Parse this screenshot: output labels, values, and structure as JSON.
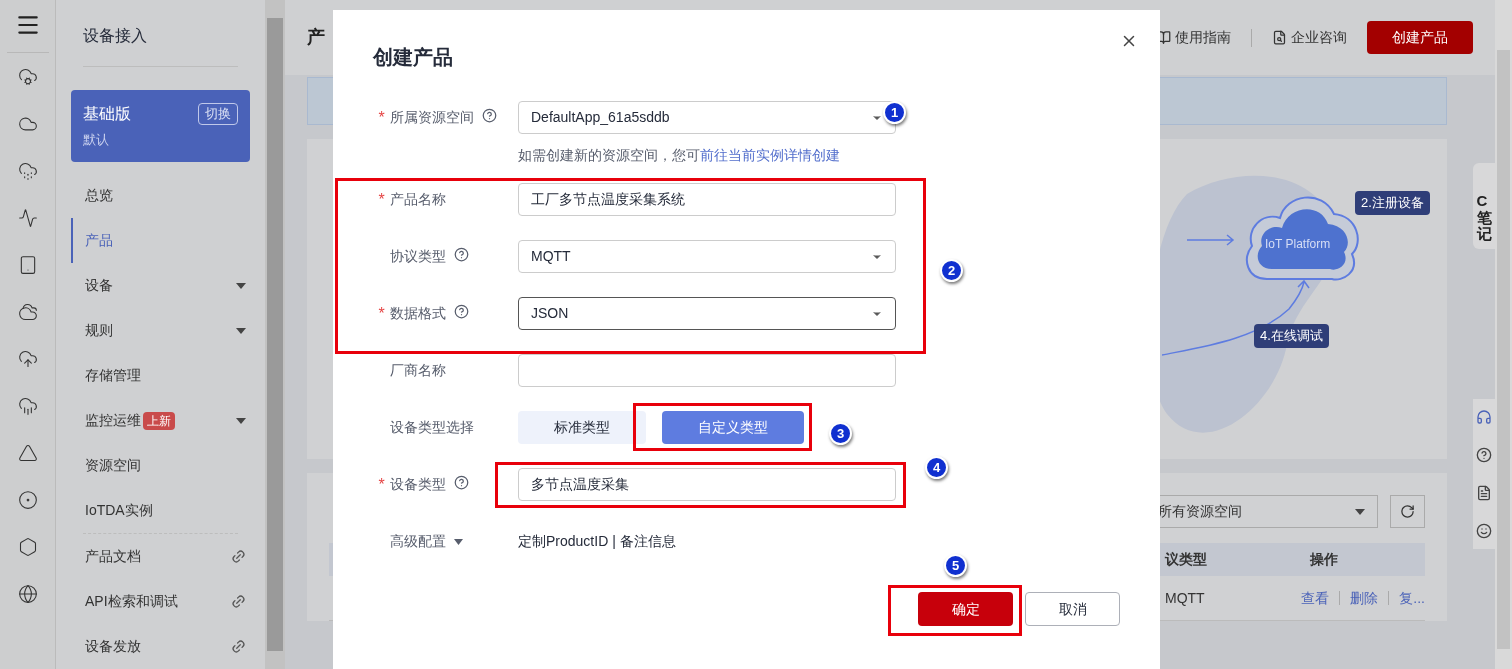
{
  "sidebar": {
    "title": "设备接入",
    "instance": {
      "name": "基础版",
      "switch": "切换",
      "note": "默认"
    },
    "items": [
      {
        "label": "总览",
        "selected": false
      },
      {
        "label": "产品",
        "selected": true
      },
      {
        "label": "设备",
        "selected": false,
        "kind": "group"
      },
      {
        "label": "规则",
        "selected": false,
        "kind": "group"
      },
      {
        "label": "存储管理",
        "selected": false
      },
      {
        "label": "监控运维",
        "selected": false,
        "kind": "group",
        "badge": "上新"
      },
      {
        "label": "资源空间",
        "selected": false
      },
      {
        "label": "IoTDA实例",
        "selected": false
      },
      {
        "label": "产品文档",
        "selected": false,
        "kind": "link"
      },
      {
        "label": "API检索和调试",
        "selected": false,
        "kind": "link"
      },
      {
        "label": "设备发放",
        "selected": false,
        "kind": "link"
      }
    ]
  },
  "header": {
    "title": "产",
    "links": [
      "使用指南",
      "企业咨询"
    ],
    "create_button": "创建产品"
  },
  "diagram": {
    "platform": "IoT Platform",
    "steps": [
      "2.注册设备",
      "4.在线调试"
    ]
  },
  "side_panel": {
    "text": "C笔记"
  },
  "table": {
    "space_select": "所有资源空间",
    "columns": [
      "议类型",
      "操作"
    ],
    "rows": [
      {
        "protocol": "MQTT",
        "actions": [
          "查看",
          "删除",
          "复..."
        ]
      }
    ]
  },
  "dialog": {
    "title": "创建产品",
    "fields": [
      {
        "kind": "select",
        "label": "所属资源空间",
        "required_mark": "*",
        "help": true,
        "value": "DefaultApp_61a5sddb",
        "focused": false,
        "hint": "如需创建新的资源空间，您可",
        "hint_link": "前往当前实例详情创建"
      },
      {
        "kind": "input",
        "label": "产品名称",
        "required_mark": "*",
        "help": false,
        "value": "工厂多节点温度采集系统"
      },
      {
        "kind": "select",
        "label": "协议类型",
        "help": true,
        "value": "MQTT",
        "focused": false
      },
      {
        "kind": "select",
        "label": "数据格式",
        "required_mark": "*",
        "help": true,
        "value": "JSON",
        "focused": true
      },
      {
        "kind": "input",
        "label": "厂商名称",
        "help": false
      },
      {
        "kind": "segmented",
        "label": "设备类型选择",
        "help": false,
        "options": [
          {
            "label": "标准类型",
            "selected": false
          },
          {
            "label": "自定义类型",
            "selected": true
          }
        ]
      },
      {
        "kind": "input",
        "label": "设备类型",
        "required_mark": "*",
        "help": true,
        "value": "多节点温度采集"
      },
      {
        "kind": "expander",
        "label": "高级配置",
        "help": false,
        "value": "定制ProductID | 备注信息"
      }
    ],
    "buttons": [
      {
        "label": "确定",
        "kind": "primary"
      },
      {
        "label": "取消",
        "kind": "secondary"
      }
    ]
  },
  "markers": [
    "1",
    "2",
    "3",
    "4",
    "5"
  ]
}
